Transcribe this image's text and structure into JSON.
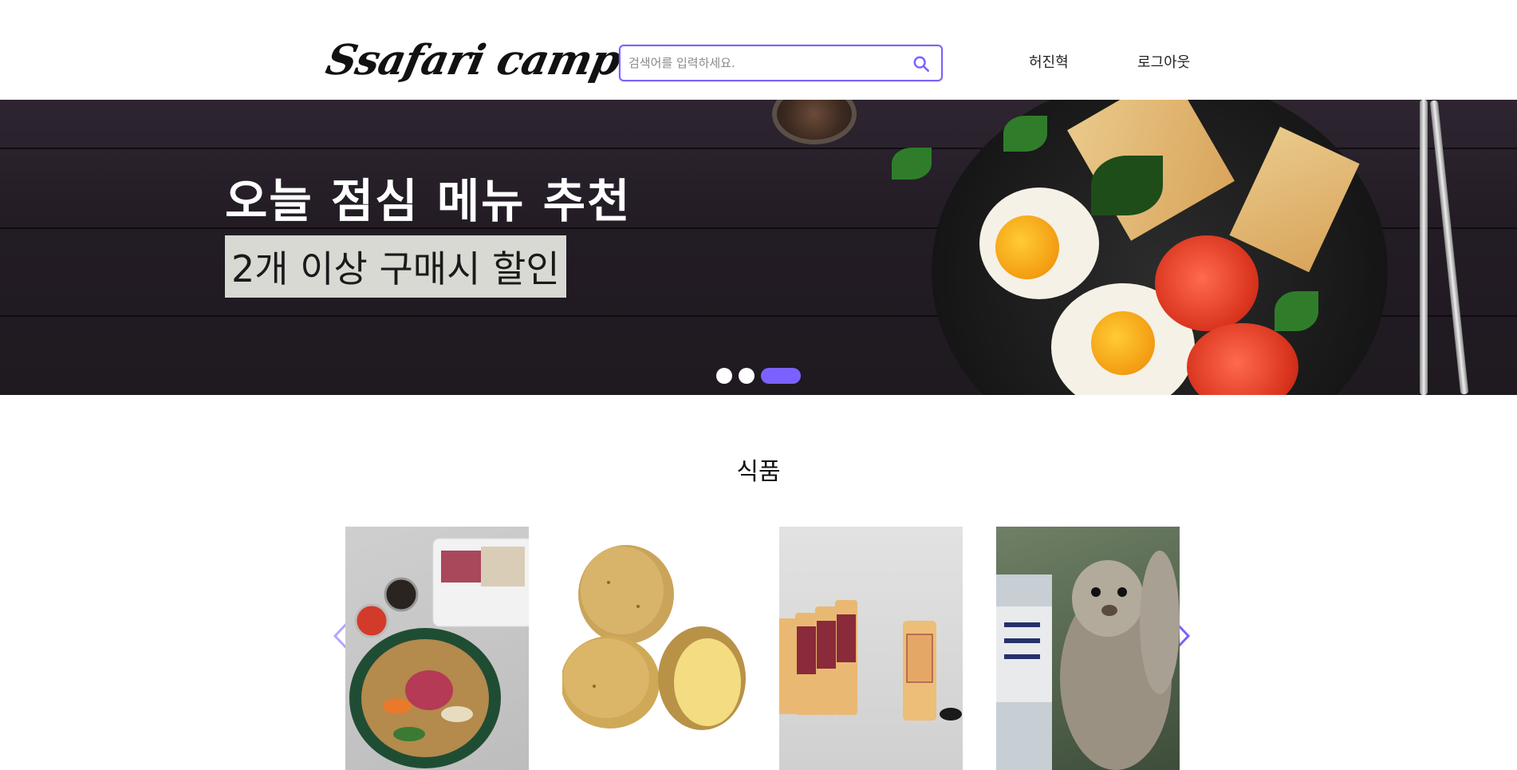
{
  "header": {
    "logo_text": "Ssafari campus",
    "search": {
      "placeholder": "검색어를 입력하세요.",
      "value": ""
    },
    "user_name": "허진혁",
    "logout_label": "로그아웃"
  },
  "hero": {
    "title": "오늘 점심 메뉴 추천",
    "subtitle": "2개 이상 구매시 할인",
    "slides": 3,
    "active_slide": 3
  },
  "section": {
    "title": "식품",
    "products": [
      {
        "name": "shabu-shabu"
      },
      {
        "name": "potato"
      },
      {
        "name": "tejava-cans"
      },
      {
        "name": "squirrel-drink"
      }
    ]
  },
  "colors": {
    "accent": "#7b61ff",
    "hero_bg": "#231c25",
    "text": "#111111"
  },
  "icons": {
    "search": "search-icon",
    "prev": "chevron-left-icon",
    "next": "chevron-right-icon"
  }
}
